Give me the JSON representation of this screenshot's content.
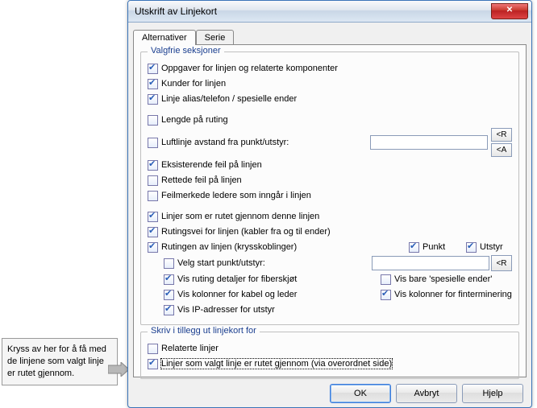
{
  "callout": "Kryss av her for å få med de linjene som valgt linje er rutet gjennom.",
  "window": {
    "title": "Utskrift av Linjekort",
    "close_glyph": "✕"
  },
  "tabs": {
    "alternativer": "Alternativer",
    "serie": "Serie"
  },
  "group1": {
    "title": "Valgfrie seksjoner",
    "oppgaver": "Oppgaver for linjen og relaterte komponenter",
    "kunder": "Kunder for linjen",
    "alias": "Linje alias/telefon / spesielle ender",
    "lengde": "Lengde på ruting",
    "luftlinje": "Luftlinje avstand fra punkt/utstyr:",
    "btn_r": "<R",
    "btn_a": "<A",
    "eksisterende": "Eksisterende feil på linjen",
    "rettede": "Rettede feil på linjen",
    "feilmerkede": "Feilmerkede ledere som inngår i linjen",
    "rutet_gjennom": "Linjer som er rutet gjennom denne linjen",
    "rutingsvei": "Rutingsvei for linjen (kabler fra og til ender)",
    "rutingen": "Rutingen av linjen (krysskoblinger)",
    "punkt": "Punkt",
    "utstyr": "Utstyr",
    "velg_start": "Velg start punkt/utstyr:",
    "vis_detaljer": "Vis ruting detaljer for fiberskjøt",
    "vis_spesielle": "Vis bare 'spesielle ender'",
    "vis_kol_kabel": "Vis kolonner for kabel og leder",
    "vis_kol_fin": "Vis kolonner for finterminering",
    "vis_ip": "Vis IP-adresser for utstyr"
  },
  "group2": {
    "title": "Skriv i tillegg ut linjekort for",
    "relaterte": "Relaterte linjer",
    "linjer_valgt": "Linjer som valgt linje er rutet gjennom (via overordnet side)"
  },
  "buttons": {
    "ok": "OK",
    "avbryt": "Avbryt",
    "hjelp": "Hjelp"
  }
}
